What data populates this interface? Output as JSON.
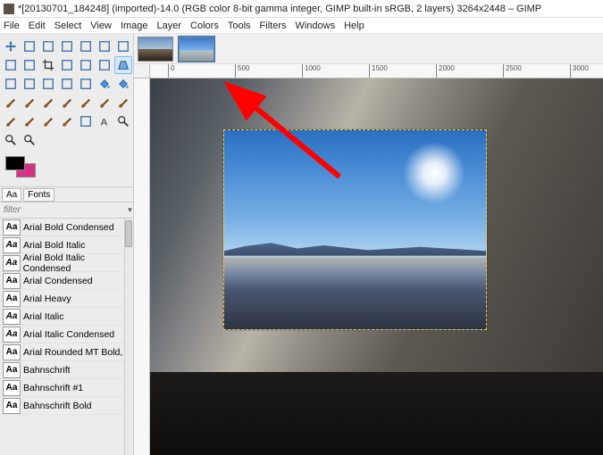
{
  "window": {
    "title": "*[20130701_184248] (imported)-14.0 (RGB color 8-bit gamma integer, GIMP built-in sRGB, 2 layers) 3264x2448 – GIMP"
  },
  "menubar": {
    "items": [
      "File",
      "Edit",
      "Select",
      "View",
      "Image",
      "Layer",
      "Colors",
      "Tools",
      "Filters",
      "Windows",
      "Help"
    ]
  },
  "toolbox": {
    "tools": [
      "move-tool",
      "align-tool",
      "rect-select-tool",
      "ellipse-select-tool",
      "free-select-tool",
      "fuzzy-select-tool",
      "by-color-select-tool",
      "scissors-select-tool",
      "foreground-select-tool",
      "crop-tool",
      "rotate-tool",
      "scale-tool",
      "shear-tool",
      "perspective-tool",
      "unified-transform-tool",
      "handle-transform-tool",
      "flip-tool",
      "cage-tool",
      "warp-tool",
      "bucket-fill-tool",
      "gradient-tool",
      "pencil-tool",
      "paintbrush-tool",
      "eraser-tool",
      "airbrush-tool",
      "ink-tool",
      "mypaint-brush-tool",
      "clone-tool",
      "heal-tool",
      "smudge-tool",
      "blur-tool",
      "dodge-burn-tool",
      "path-tool",
      "text-tool",
      "color-picker-tool",
      "measure-tool",
      "zoom-tool"
    ],
    "highlighted": "perspective-tool",
    "fg_color": "#000000",
    "bg_color": "#d63384"
  },
  "dock": {
    "tabs": [
      {
        "label": "Aa",
        "active": true,
        "name": "fonts-tab"
      },
      {
        "label": "Fonts",
        "active": false,
        "name": "fonts-label-tab"
      }
    ],
    "filter_placeholder": "filter"
  },
  "font_list": [
    {
      "name": "Arial Bold Condensed",
      "style": "bold"
    },
    {
      "name": "Arial Bold Italic",
      "style": "bolditalic"
    },
    {
      "name": "Arial Bold Italic Condensed",
      "style": "bolditalic"
    },
    {
      "name": "Arial Condensed",
      "style": "normal"
    },
    {
      "name": "Arial Heavy",
      "style": "bold"
    },
    {
      "name": "Arial Italic",
      "style": "italic"
    },
    {
      "name": "Arial Italic Condensed",
      "style": "italic"
    },
    {
      "name": "Arial Rounded MT Bold,",
      "style": "bold"
    },
    {
      "name": "Bahnschrift",
      "style": "normal"
    },
    {
      "name": "Bahnschrift #1",
      "style": "normal"
    },
    {
      "name": "Bahnschrift Bold",
      "style": "bold"
    }
  ],
  "thumbs": [
    {
      "name": "layer-thumb-1",
      "active": false
    },
    {
      "name": "layer-thumb-2",
      "active": true
    }
  ],
  "ruler": {
    "ticks": [
      "0",
      "500",
      "1000",
      "1500",
      "2000",
      "2500",
      "3000"
    ]
  },
  "arrow": {
    "color": "#ff0000"
  }
}
